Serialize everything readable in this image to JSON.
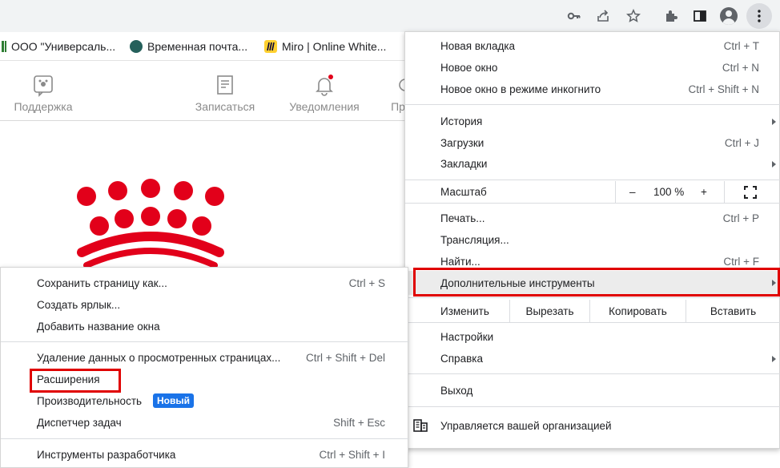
{
  "toolbar": {
    "icons": [
      "key-icon",
      "share-icon",
      "star-icon",
      "extensions-icon",
      "sidepanel-icon",
      "profile-icon",
      "kebab-menu-icon"
    ]
  },
  "bookmarks": [
    {
      "label": "ООО \"Универсаль...",
      "icon": "bars-icon"
    },
    {
      "label": "Временная почта...",
      "icon": "globe-icon"
    },
    {
      "label": "Miro | Online White...",
      "icon": "miro-icon"
    }
  ],
  "sitenav": {
    "items": [
      {
        "label": "Поддержка",
        "icon": "support-icon"
      },
      {
        "label": "Записаться",
        "icon": "signup-icon"
      },
      {
        "label": "Уведомления",
        "icon": "bell-icon"
      },
      {
        "label": "Пр",
        "icon": "partial-icon"
      }
    ]
  },
  "menu": {
    "new_tab": {
      "label": "Новая вкладка",
      "shortcut": "Ctrl + T"
    },
    "new_window": {
      "label": "Новое окно",
      "shortcut": "Ctrl + N"
    },
    "incognito": {
      "label": "Новое окно в режиме инкогнито",
      "shortcut": "Ctrl + Shift + N"
    },
    "history": {
      "label": "История"
    },
    "downloads": {
      "label": "Загрузки",
      "shortcut": "Ctrl + J"
    },
    "bookmarks": {
      "label": "Закладки"
    },
    "zoom": {
      "label": "Масштаб",
      "minus": "–",
      "value": "100 %",
      "plus": "+"
    },
    "print": {
      "label": "Печать...",
      "shortcut": "Ctrl + P"
    },
    "cast": {
      "label": "Трансляция..."
    },
    "find": {
      "label": "Найти...",
      "shortcut": "Ctrl + F"
    },
    "more_tools": {
      "label": "Дополнительные инструменты"
    },
    "edit": {
      "label": "Изменить",
      "cut": "Вырезать",
      "copy": "Копировать",
      "paste": "Вставить"
    },
    "settings": {
      "label": "Настройки"
    },
    "help": {
      "label": "Справка"
    },
    "exit": {
      "label": "Выход"
    },
    "managed": {
      "label": "Управляется вашей организацией"
    }
  },
  "submenu": {
    "save_page": {
      "label": "Сохранить страницу как...",
      "shortcut": "Ctrl + S"
    },
    "create_shortcut": {
      "label": "Создать ярлык..."
    },
    "name_window": {
      "label": "Добавить название окна"
    },
    "clear_data": {
      "label": "Удаление данных о просмотренных страницах...",
      "shortcut": "Ctrl + Shift + Del"
    },
    "extensions": {
      "label": "Расширения"
    },
    "performance": {
      "label": "Производительность",
      "badge": "Новый"
    },
    "task_manager": {
      "label": "Диспетчер задач",
      "shortcut": "Shift + Esc"
    },
    "dev_tools": {
      "label": "Инструменты разработчика",
      "shortcut": "Ctrl + Shift + I"
    }
  },
  "colors": {
    "highlight": "#e00000",
    "badge": "#1a73e8",
    "logo_red": "#e2001a"
  }
}
